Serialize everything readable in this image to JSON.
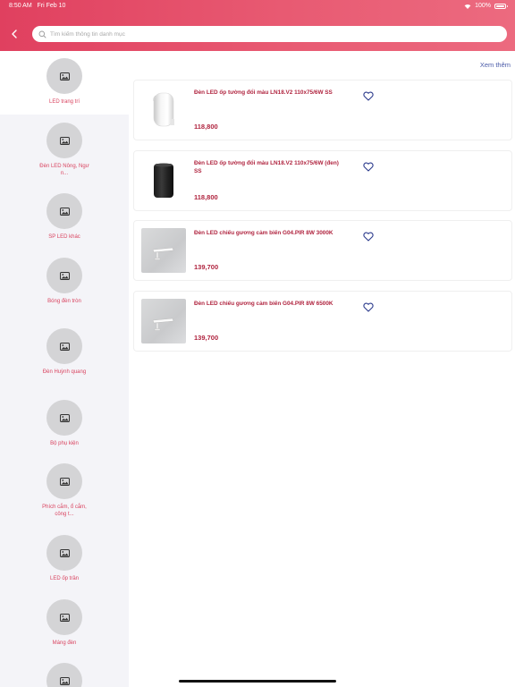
{
  "status_bar": {
    "time": "8:50 AM",
    "date": "Fri Feb 10",
    "battery": "100%"
  },
  "search": {
    "placeholder": "Tìm kiếm thông tin danh mục"
  },
  "see_more": "Xem thêm",
  "categories": [
    {
      "label": "LED trang trí",
      "active": true
    },
    {
      "label": "Đèn LED Nông, Ngư n...",
      "active": false
    },
    {
      "label": "SP LED khác",
      "active": false
    },
    {
      "label": "Bóng đèn tròn",
      "active": false
    },
    {
      "label": "Đèn Huỳnh quang",
      "active": false
    },
    {
      "label": "Bộ phụ kiện",
      "active": false
    },
    {
      "label": "Phích cắm, ổ cắm, công t...",
      "active": false
    },
    {
      "label": "LED ốp trần",
      "active": false
    },
    {
      "label": "Máng đèn",
      "active": false
    },
    {
      "label": "",
      "active": false
    }
  ],
  "products": [
    {
      "title": "Đèn LED ốp tường đổi màu LN18.V2 110x75/6W SS",
      "price": "118,800",
      "image": "white-wall-light"
    },
    {
      "title": "Đèn LED ốp tường đổi màu LN18.V2 110x75/6W (đen) SS",
      "price": "118,800",
      "image": "black-wall-light"
    },
    {
      "title": "Đèn LED chiếu gương cảm biến G04.PIR 8W 3000K",
      "price": "139,700",
      "image": "mirror-light"
    },
    {
      "title": "Đèn LED chiếu gương cảm biến G04.PIR 8W 6500K",
      "price": "139,700",
      "image": "mirror-light"
    }
  ],
  "colors": {
    "brand": "#e0405f",
    "price": "#b0243f",
    "link": "#4a5aa8"
  }
}
